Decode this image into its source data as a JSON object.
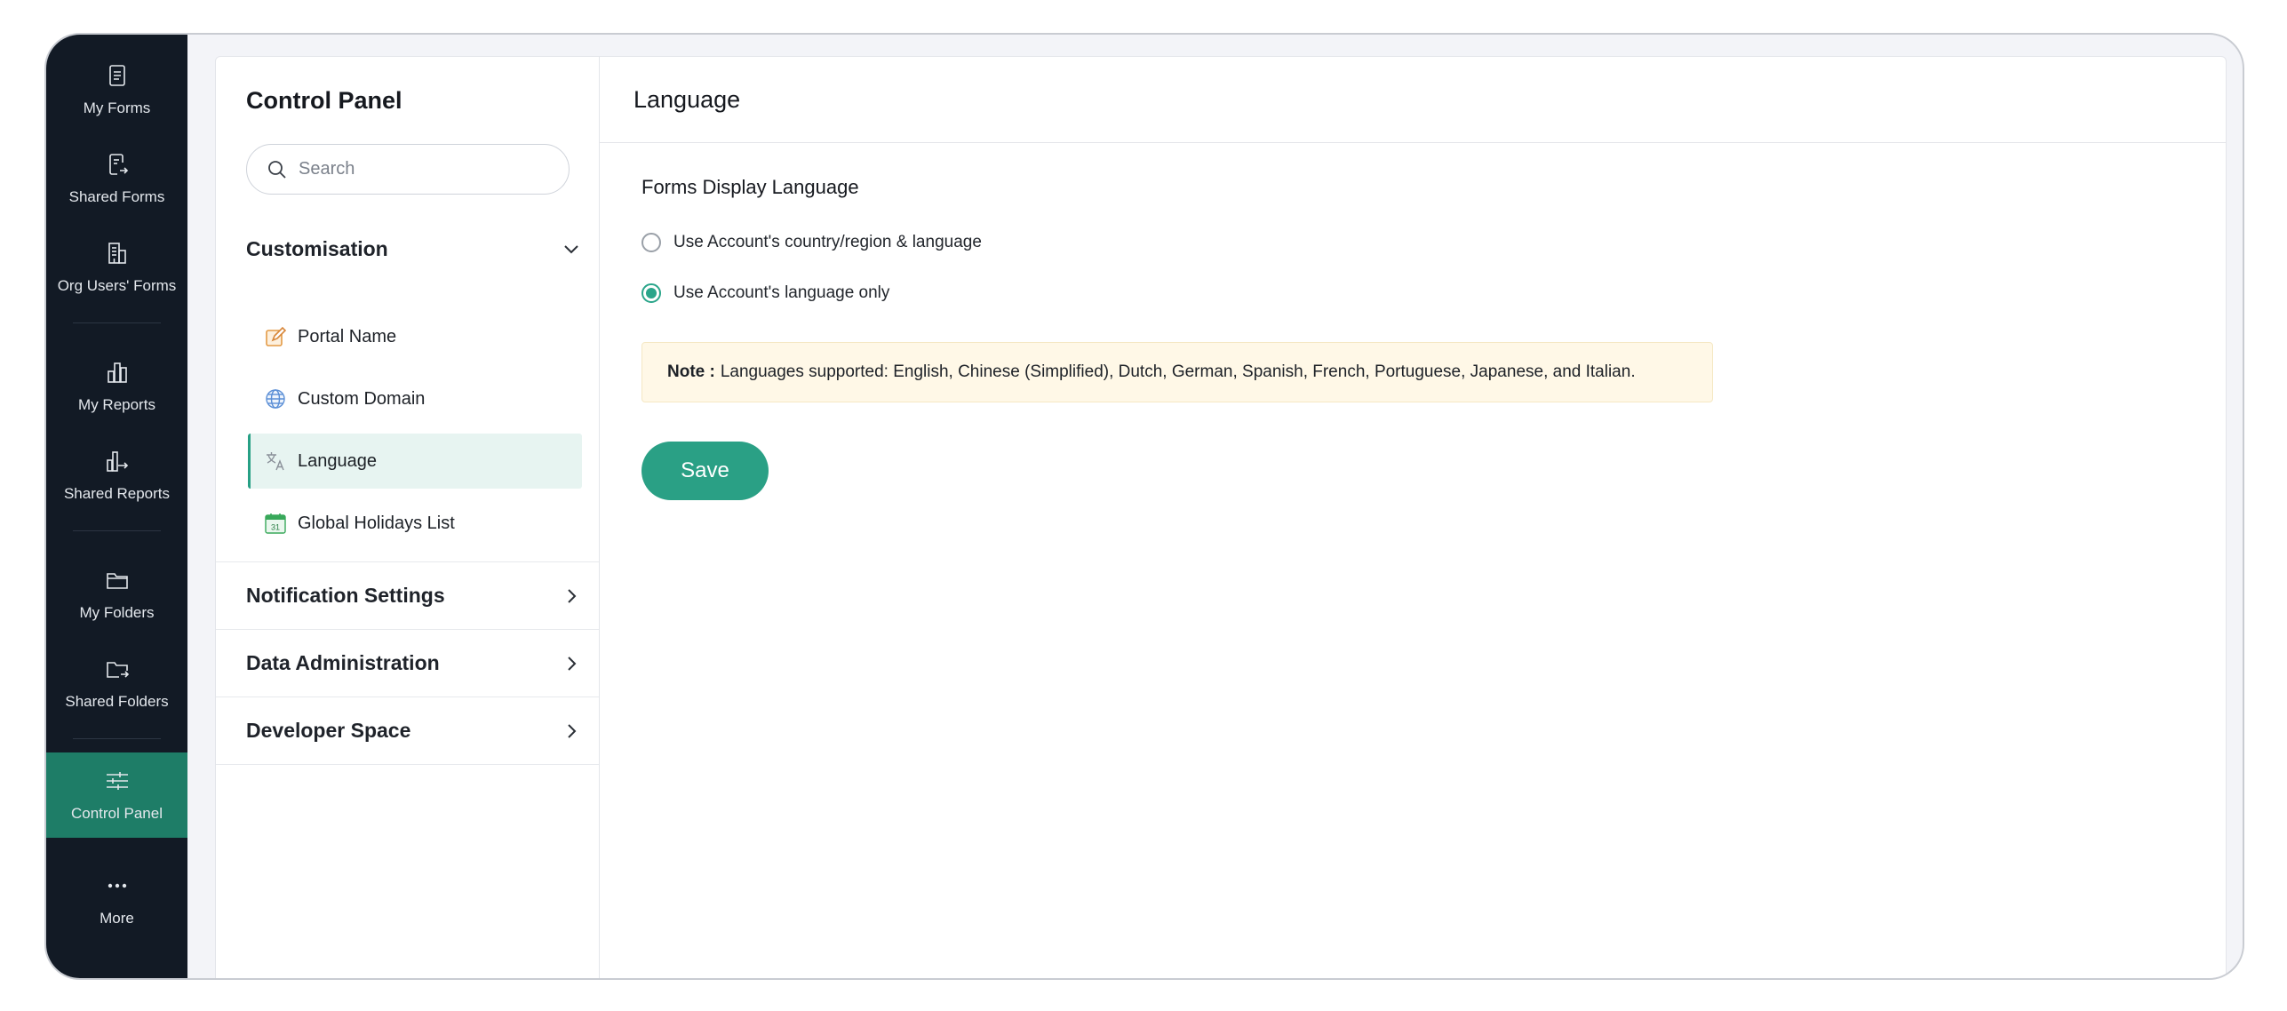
{
  "sidebar": {
    "items": [
      {
        "label": "My Forms",
        "icon": "form-icon"
      },
      {
        "label": "Shared Forms",
        "icon": "shared-form-icon"
      },
      {
        "label": "Org Users' Forms",
        "icon": "org-building-icon"
      },
      {
        "label": "My Reports",
        "icon": "bar-chart-icon"
      },
      {
        "label": "Shared Reports",
        "icon": "shared-chart-icon"
      },
      {
        "label": "My Folders",
        "icon": "folder-icon"
      },
      {
        "label": "Shared Folders",
        "icon": "shared-folder-icon"
      },
      {
        "label": "Control Panel",
        "icon": "sliders-icon",
        "active": true
      },
      {
        "label": "More",
        "icon": "more-dots-icon"
      }
    ]
  },
  "control_panel": {
    "title": "Control Panel",
    "search": {
      "placeholder": "Search",
      "value": ""
    },
    "sections": [
      {
        "label": "Customisation",
        "expanded": true,
        "items": [
          {
            "label": "Portal Name",
            "icon": "edit-pencil-icon"
          },
          {
            "label": "Custom Domain",
            "icon": "globe-icon"
          },
          {
            "label": "Language",
            "icon": "translate-icon",
            "active": true
          },
          {
            "label": "Global Holidays List",
            "icon": "calendar-31-icon",
            "calendar_number": "31"
          }
        ]
      },
      {
        "label": "Notification Settings",
        "expanded": false
      },
      {
        "label": "Data Administration",
        "expanded": false
      },
      {
        "label": "Developer Space",
        "expanded": false
      }
    ]
  },
  "main": {
    "title": "Language",
    "group_title": "Forms Display Language",
    "options": [
      {
        "label": "Use Account's country/region & language",
        "selected": false
      },
      {
        "label": "Use Account's language only",
        "selected": true
      }
    ],
    "note": {
      "label": "Note :",
      "text": "Languages supported: English, Chinese (Simplified), Dutch, German, Spanish, French, Portuguese, Japanese, and Italian."
    },
    "save_label": "Save"
  },
  "colors": {
    "rail_bg": "#121a25",
    "accent": "#2aa085",
    "active_rail": "#1e7d67",
    "note_bg": "#fff8e7"
  }
}
